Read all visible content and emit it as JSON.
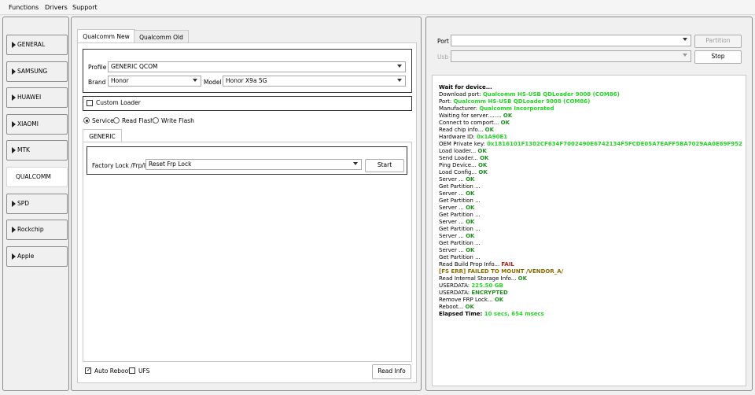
{
  "menu": [
    "Functions",
    "Drivers",
    "Support"
  ],
  "sidebar": [
    "GENERAL",
    "SAMSUNG",
    "HUAWEI",
    "XIAOMI",
    "MTK",
    "QUALCOMM",
    "SPD",
    "Rockchip",
    "Apple"
  ],
  "tabs": [
    "Qualcomm New",
    "Qualcomm Old"
  ],
  "form": {
    "profile_label": "Profile",
    "profile_value": "GENERIC QCOM",
    "brand_label": "Brand",
    "brand_value": "Honor",
    "model_label": "Model",
    "model_value": "Honor X9a 5G",
    "custom_loader": "Custom Loader",
    "modes": [
      "Service",
      "Read Flash",
      "Write Flash"
    ],
    "inner_tab": "GENERIC",
    "factory_label": "Factory Lock /Frp/ID",
    "factory_value": "Reset Frp Lock",
    "start": "Start",
    "auto_reboot": "Auto Reboot",
    "ufs": "UFS",
    "read_info": "Read Info"
  },
  "right": {
    "port_label": "Port",
    "usb_label": "Usb",
    "partition": "Partition",
    "stop": "Stop"
  },
  "log": [
    [
      {
        "t": "Wait for device...",
        "c": "b"
      }
    ],
    [
      {
        "t": "Download port: ",
        "c": ""
      },
      {
        "t": "Qualcomm HS-USB QDLoader 9008 (COM86)",
        "c": "g"
      }
    ],
    [
      {
        "t": "Port: ",
        "c": ""
      },
      {
        "t": "Qualcomm HS-USB QDLoader 9008 (COM86)",
        "c": "g"
      }
    ],
    [
      {
        "t": "Manufacturer: ",
        "c": ""
      },
      {
        "t": "Qualcomm Incorporated",
        "c": "g"
      }
    ],
    [
      {
        "t": "Waiting for server........ ",
        "c": ""
      },
      {
        "t": "OK",
        "c": "ok"
      }
    ],
    [
      {
        "t": "Connect to comport... ",
        "c": ""
      },
      {
        "t": "OK",
        "c": "ok"
      }
    ],
    [
      {
        "t": "Read chip info... ",
        "c": ""
      },
      {
        "t": "OK",
        "c": "ok"
      }
    ],
    [
      {
        "t": "Hardware ID: ",
        "c": ""
      },
      {
        "t": "0x1A90E1",
        "c": "g"
      }
    ],
    [
      {
        "t": "OEM Private key: ",
        "c": ""
      },
      {
        "t": "0x1816101F1302CF634F7002490E6742134F5FCDE05A7EAFF5BA7029AA0E69F952",
        "c": "g"
      }
    ],
    [
      {
        "t": "Load loader... ",
        "c": ""
      },
      {
        "t": "OK",
        "c": "ok"
      }
    ],
    [
      {
        "t": "Send Loader... ",
        "c": ""
      },
      {
        "t": "OK",
        "c": "ok"
      }
    ],
    [
      {
        "t": "Ping Device... ",
        "c": ""
      },
      {
        "t": "OK",
        "c": "ok"
      }
    ],
    [
      {
        "t": "Load Config... ",
        "c": ""
      },
      {
        "t": "OK",
        "c": "ok"
      }
    ],
    [
      {
        "t": "Server ... ",
        "c": ""
      },
      {
        "t": "OK",
        "c": "ok"
      }
    ],
    [
      {
        "t": "Get Partition ... ",
        "c": ""
      }
    ],
    [
      {
        "t": "Server ... ",
        "c": ""
      },
      {
        "t": "OK",
        "c": "ok"
      }
    ],
    [
      {
        "t": "Get Partition ... ",
        "c": ""
      }
    ],
    [
      {
        "t": "Server ... ",
        "c": ""
      },
      {
        "t": "OK",
        "c": "ok"
      }
    ],
    [
      {
        "t": "Get Partition ... ",
        "c": ""
      }
    ],
    [
      {
        "t": "Server ... ",
        "c": ""
      },
      {
        "t": "OK",
        "c": "ok"
      }
    ],
    [
      {
        "t": "Get Partition ... ",
        "c": ""
      }
    ],
    [
      {
        "t": "Server ... ",
        "c": ""
      },
      {
        "t": "OK",
        "c": "ok"
      }
    ],
    [
      {
        "t": "Get Partition ... ",
        "c": ""
      }
    ],
    [
      {
        "t": "Server ... ",
        "c": ""
      },
      {
        "t": "OK",
        "c": "ok"
      }
    ],
    [
      {
        "t": "Get Partition ... ",
        "c": ""
      }
    ],
    [
      {
        "t": "Read Build Prop Info... ",
        "c": ""
      },
      {
        "t": "FAIL",
        "c": "fail"
      }
    ],
    [
      {
        "t": "  [FS ERR] FAILED TO MOUNT /VENDOR_A/",
        "c": "err"
      }
    ],
    [
      {
        "t": "Read Internal Storage Info... ",
        "c": ""
      },
      {
        "t": "OK",
        "c": "ok"
      }
    ],
    [
      {
        "t": "USERDATA: ",
        "c": ""
      },
      {
        "t": "225.50 GB",
        "c": "g"
      }
    ],
    [
      {
        "t": "USERDATA: ",
        "c": ""
      },
      {
        "t": "ENCRYPTED",
        "c": "ok"
      }
    ],
    [
      {
        "t": "Remove FRP Lock... ",
        "c": ""
      },
      {
        "t": "OK",
        "c": "ok"
      }
    ],
    [
      {
        "t": "Reboot... ",
        "c": ""
      },
      {
        "t": "OK",
        "c": "ok"
      }
    ],
    [
      {
        "t": "Elapsed Time: ",
        "c": "b"
      },
      {
        "t": "10 secs, 654 msecs",
        "c": "g"
      }
    ]
  ]
}
